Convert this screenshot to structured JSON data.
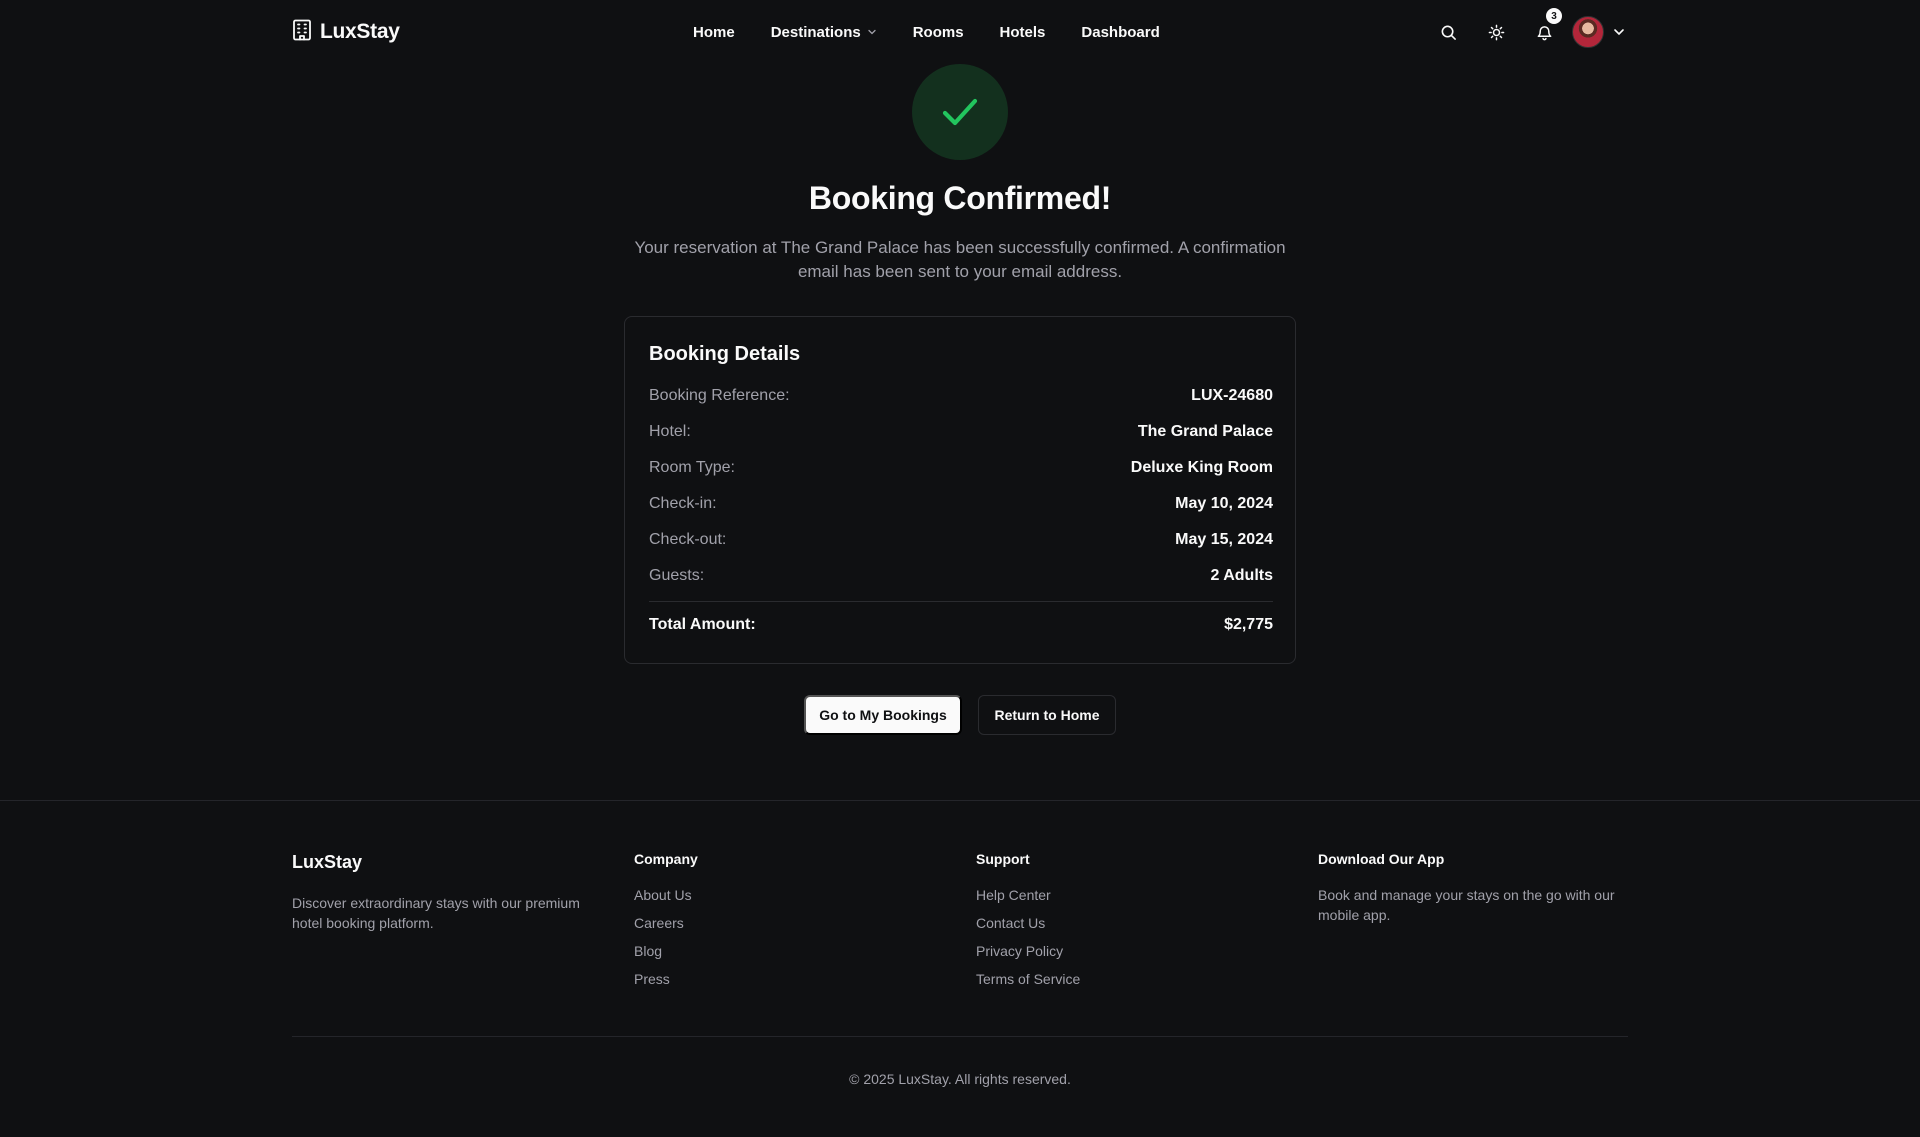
{
  "brand": {
    "name": "LuxStay",
    "logo_icon": "building-icon"
  },
  "nav": {
    "items": [
      {
        "label": "Home"
      },
      {
        "label": "Destinations",
        "has_dropdown": true
      },
      {
        "label": "Rooms"
      },
      {
        "label": "Hotels"
      },
      {
        "label": "Dashboard"
      }
    ]
  },
  "header_actions": {
    "search_icon": "search-icon",
    "theme_icon": "sun-icon",
    "notifications_icon": "bell-icon",
    "notification_count": "3",
    "avatar": "user-avatar"
  },
  "confirmation": {
    "icon": "check-icon",
    "title": "Booking Confirmed!",
    "message": "Your reservation at The Grand Palace has been successfully confirmed. A confirmation email has been sent to your email address."
  },
  "booking_details": {
    "title": "Booking Details",
    "rows": [
      {
        "label": "Booking Reference:",
        "value": "LUX-24680"
      },
      {
        "label": "Hotel:",
        "value": "The Grand Palace"
      },
      {
        "label": "Room Type:",
        "value": "Deluxe King Room"
      },
      {
        "label": "Check-in:",
        "value": "May 10, 2024"
      },
      {
        "label": "Check-out:",
        "value": "May 15, 2024"
      },
      {
        "label": "Guests:",
        "value": "2 Adults"
      }
    ],
    "total": {
      "label": "Total Amount:",
      "value": "$2,775"
    }
  },
  "actions": {
    "primary": "Go to My Bookings",
    "secondary": "Return to Home"
  },
  "footer": {
    "brand": "LuxStay",
    "description": "Discover extraordinary stays with our premium hotel booking platform.",
    "company": {
      "heading": "Company",
      "links": [
        "About Us",
        "Careers",
        "Blog",
        "Press"
      ]
    },
    "support": {
      "heading": "Support",
      "links": [
        "Help Center",
        "Contact Us",
        "Privacy Policy",
        "Terms of Service"
      ]
    },
    "app": {
      "heading": "Download Our App",
      "description": "Book and manage your stays on the go with our mobile app."
    },
    "copyright": "© 2025 LuxStay. All rights reserved."
  },
  "colors": {
    "background": "#0f1012",
    "text": "#fafafa",
    "muted": "#a1a1aa",
    "border": "#2a2b2f",
    "success_bg": "#13301e",
    "success": "#22c55e"
  }
}
